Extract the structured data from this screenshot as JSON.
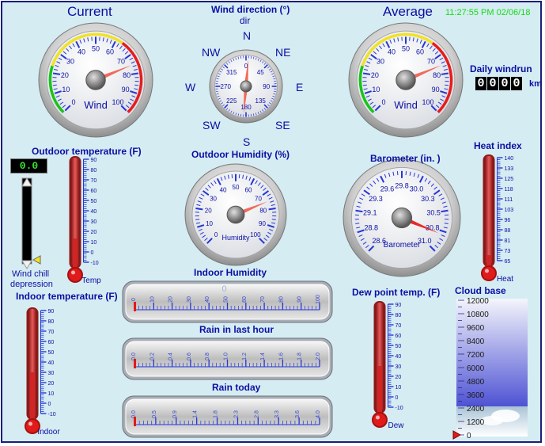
{
  "clock": "11:27:55 PM 02/06/18",
  "current_wind": {
    "title": "Current",
    "gauge_label": "Wind",
    "ticks": [
      "0",
      "10",
      "20",
      "30",
      "40",
      "50",
      "60",
      "70",
      "80",
      "90",
      "100"
    ],
    "value": 75
  },
  "average_wind": {
    "title": "Average",
    "gauge_label": "Wind",
    "ticks": [
      "0",
      "10",
      "20",
      "30",
      "40",
      "50",
      "60",
      "70",
      "80",
      "90",
      "100"
    ],
    "value": 75
  },
  "wind_direction": {
    "title": "Wind direction (°)",
    "subtitle": "dir",
    "compass": [
      "N",
      "NE",
      "E",
      "SE",
      "S",
      "SW",
      "W",
      "NW"
    ],
    "dial_ticks": [
      "0",
      "45",
      "90",
      "135",
      "180",
      "225",
      "270",
      "315"
    ],
    "value_deg": 5
  },
  "daily_windrun": {
    "label": "Daily windrun",
    "digits": [
      "0",
      "0",
      "0",
      "0"
    ],
    "unit": "km"
  },
  "outdoor_temp": {
    "label": "Outdoor temperature (F)",
    "scale": [
      "90",
      "80",
      "70",
      "60",
      "50",
      "40",
      "30",
      "20",
      "10",
      "0",
      "-10"
    ],
    "value": 13,
    "caption": "Temp"
  },
  "wind_chill": {
    "display": "0.0",
    "caption_line1": "Wind chill",
    "caption_line2": "depression"
  },
  "outdoor_humidity": {
    "label": "Outdoor Humidity (%)",
    "gauge_label": "Humidity",
    "ticks": [
      "0",
      "10",
      "20",
      "30",
      "40",
      "50",
      "60",
      "70",
      "80",
      "90",
      "100"
    ],
    "value": 75
  },
  "barometer": {
    "label": "Barometer (in. )",
    "gauge_label": "Barometer",
    "ticks": [
      "28.6",
      "28.8",
      "29.1",
      "29.3",
      "29.6",
      "29.8",
      "30.0",
      "30.3",
      "30.5",
      "30.8",
      "31.0"
    ],
    "value": 30.8
  },
  "heat_index": {
    "label": "Heat index",
    "scale": [
      "140",
      "133",
      "125",
      "118",
      "111",
      "103",
      "96",
      "88",
      "81",
      "73",
      "65"
    ],
    "value": 69,
    "caption": "Heat"
  },
  "indoor_humidity": {
    "label": "Indoor Humidity",
    "value_text": "0",
    "scale": [
      "0",
      "10",
      "20",
      "30",
      "40",
      "50",
      "60",
      "70",
      "80",
      "90",
      "100"
    ]
  },
  "rain_last_hour": {
    "label": "Rain in last hour",
    "scale": [
      "0.0",
      "0.2",
      "0.4",
      "0.6",
      "0.8",
      "1.0",
      "1.2",
      "1.4",
      "1.6",
      "1.8",
      "2.0"
    ]
  },
  "rain_today": {
    "label": "Rain today",
    "scale": [
      "0.0",
      "0.5",
      "0.9",
      "1.4",
      "1.8",
      "2.3",
      "2.8",
      "3.3",
      "3.6",
      "4.0"
    ]
  },
  "indoor_temp": {
    "label": "Indoor temperature (F)",
    "scale": [
      "90",
      "80",
      "70",
      "60",
      "50",
      "40",
      "30",
      "20",
      "10",
      "0",
      "-10"
    ],
    "value": 30,
    "caption": "Indoor"
  },
  "dew_point": {
    "label": "Dew point temp. (F)",
    "scale": [
      "90",
      "80",
      "70",
      "60",
      "50",
      "40",
      "30",
      "20",
      "10",
      "0",
      "-10"
    ],
    "value": 30,
    "caption": "Dew"
  },
  "cloud_base": {
    "label": "Cloud base",
    "scale": [
      "12000",
      "10800",
      "9600",
      "8400",
      "7200",
      "6000",
      "4800",
      "3600",
      "2400",
      "1200",
      "0"
    ],
    "value": 0
  },
  "colors": {
    "text": "#0b0fa3",
    "panel": "#d5ecf2",
    "needle": "#f06a5c",
    "mercury": "#c41e1e"
  }
}
